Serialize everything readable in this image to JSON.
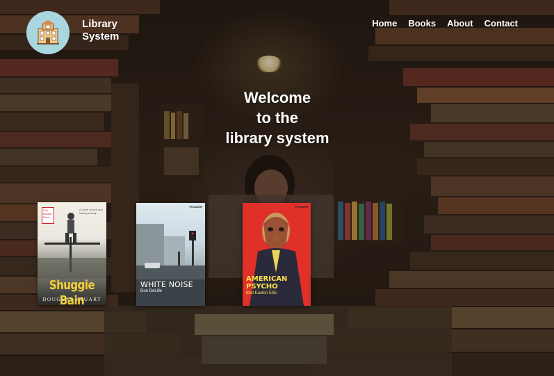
{
  "brand": {
    "name_line1": "Library",
    "name_line2": "System",
    "logo_icon": "library-building-icon"
  },
  "nav": {
    "home": "Home",
    "books": "Books",
    "about": "About",
    "contact": "Contact"
  },
  "hero": {
    "line1": "Welcome",
    "line2": "to the",
    "line3": "library system"
  },
  "books": [
    {
      "title": "Shuggie Bain",
      "author": "DOUGLAS STUART",
      "prize_badge": "The Booker Prize",
      "quote": "A novel of rare and lasting beauty",
      "title_color": "#f3cf34"
    },
    {
      "title": "WHITE NOISE",
      "author": "Don DeLillo",
      "publisher": "PICADOR"
    },
    {
      "title": "AMERICAN PSYCHO",
      "author": "Bret Easton Ellis",
      "publisher": "PICADOR",
      "title_color": "#ffe24a"
    }
  ],
  "colors": {
    "logo_bg": "#a9d7df",
    "text": "#ffffff",
    "psycho_cover": "#e0302a"
  }
}
